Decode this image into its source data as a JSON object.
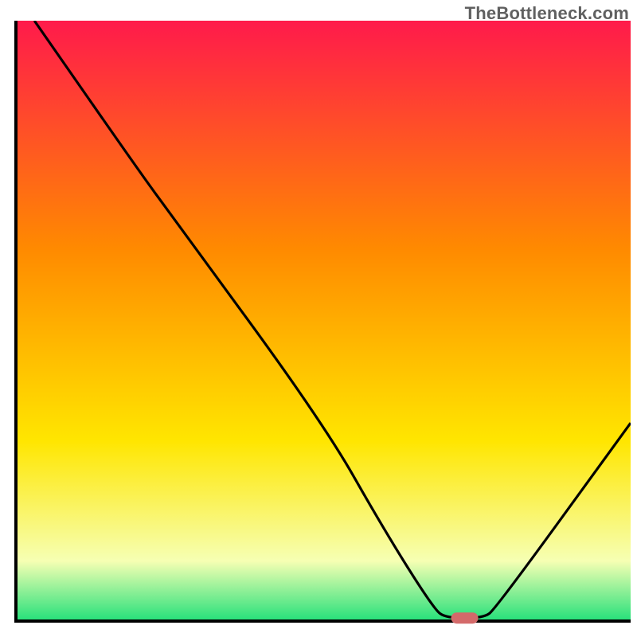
{
  "watermark": "TheBottleneck.com",
  "chart_data": {
    "type": "line",
    "title": "",
    "xlabel": "",
    "ylabel": "",
    "xlim": [
      0,
      100
    ],
    "ylim": [
      0,
      100
    ],
    "grid": false,
    "legend": false,
    "series": [
      {
        "name": "curve",
        "points": [
          {
            "x": 3.0,
            "y": 100.0
          },
          {
            "x": 20.0,
            "y": 75.0
          },
          {
            "x": 25.0,
            "y": 68.0
          },
          {
            "x": 50.0,
            "y": 33.0
          },
          {
            "x": 60.0,
            "y": 15.0
          },
          {
            "x": 68.0,
            "y": 2.0
          },
          {
            "x": 70.0,
            "y": 0.5
          },
          {
            "x": 76.0,
            "y": 0.5
          },
          {
            "x": 78.0,
            "y": 2.0
          },
          {
            "x": 100.0,
            "y": 33.0
          }
        ]
      }
    ],
    "marker": {
      "x": 73.0,
      "y": 0.5,
      "color": "#d46a6a"
    },
    "gradient_colors": {
      "top": "#ff1a4b",
      "mid1": "#ff8a00",
      "mid2": "#ffe600",
      "low": "#f6ffb3",
      "bottom": "#24e07a"
    },
    "axis_color": "#000000",
    "curve_color": "#000000"
  }
}
